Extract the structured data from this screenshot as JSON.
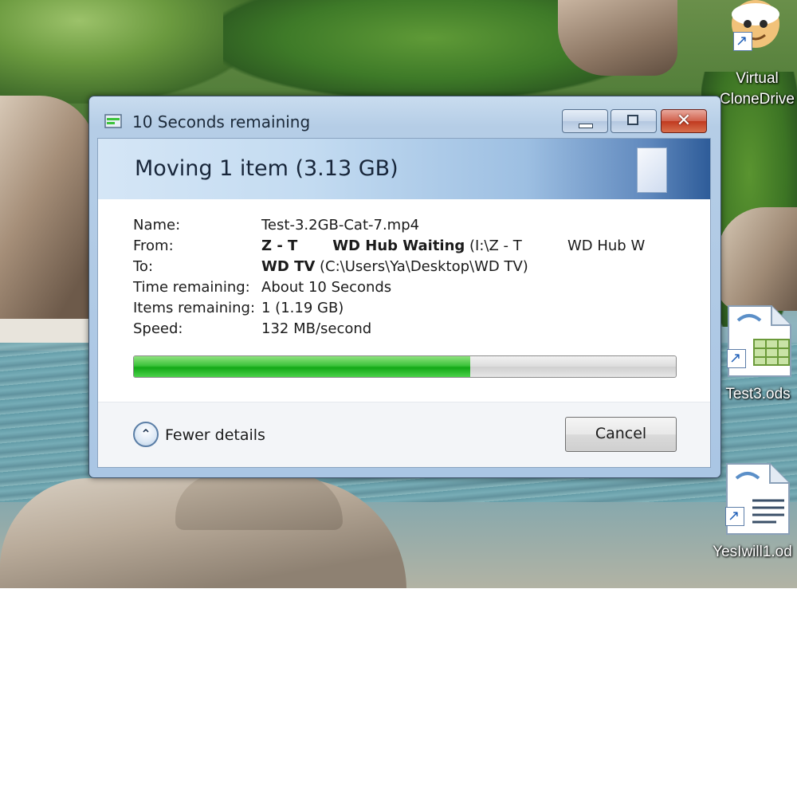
{
  "desktop": {
    "icons": [
      {
        "label": "Virtual",
        "label2": "CloneDrive",
        "icon": "virtual-clonedrive-icon"
      },
      {
        "label": "Test3.ods",
        "icon": "spreadsheet-icon"
      },
      {
        "label": "YesIwill1.od",
        "icon": "text-document-icon"
      }
    ]
  },
  "dialog": {
    "title": "10 Seconds remaining",
    "heading": "Moving 1 item (3.13 GB)",
    "details": {
      "name_label": "Name:",
      "name_value": "Test-3.2GB-Cat-7.mp4",
      "from_label": "From:",
      "from_bold": "Z - T       WD Hub Waiting",
      "from_rest": "(I:\\Z - T          WD Hub W",
      "to_label": "To:",
      "to_bold": "WD TV",
      "to_rest": "(C:\\Users\\Ya\\Desktop\\WD TV)",
      "time_label": "Time remaining:",
      "time_value": "About 10 Seconds",
      "items_label": "Items remaining:",
      "items_value": "1 (1.19 GB)",
      "speed_label": "Speed:",
      "speed_value": "132 MB/second"
    },
    "progress_fraction": 0.62,
    "progress_color": "#23b523",
    "fewer_details_label": "Fewer details",
    "cancel_label": "Cancel"
  }
}
